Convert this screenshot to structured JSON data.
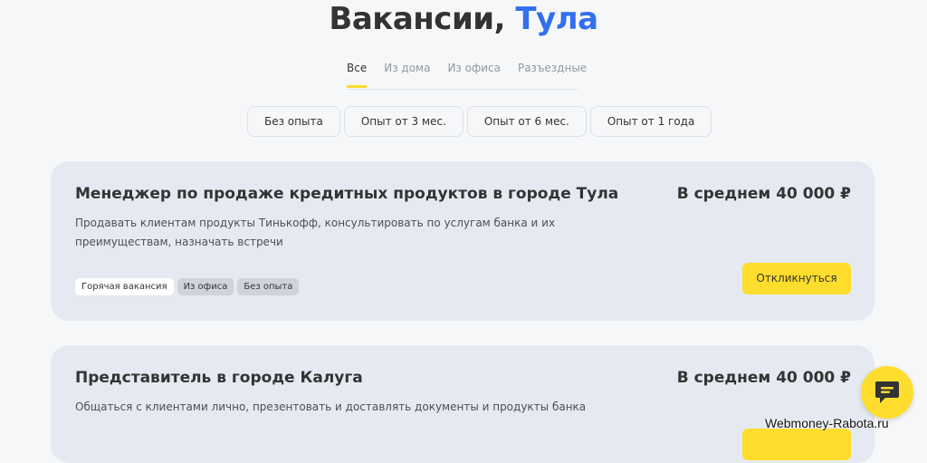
{
  "header": {
    "title_main": "Вакансии, ",
    "title_city": "Тула"
  },
  "tabs": [
    {
      "label": "Все",
      "active": true
    },
    {
      "label": "Из дома",
      "active": false
    },
    {
      "label": "Из офиса",
      "active": false
    },
    {
      "label": "Разъездные",
      "active": false
    }
  ],
  "filters": [
    "Без опыта",
    "Опыт от 3 мес.",
    "Опыт от 6 мес.",
    "Опыт от 1 года"
  ],
  "vacancies": [
    {
      "title": "Менеджер по продаже кредитных продуктов в городе Тула",
      "salary": "В среднем 40 000 ₽",
      "description": "Продавать клиентам продукты Тинькофф, консультировать по услугам банка и их преимуществам, назначать встречи",
      "badges": [
        "Горячая вакансия",
        "Из офиса",
        "Без опыта"
      ],
      "apply_label": "Откликнуться"
    },
    {
      "title": "Представитель в городе Калуга",
      "salary": "В среднем 40 000 ₽",
      "description": "Общаться с клиентами лично, презентовать и доставлять документы и продукты банка"
    }
  ],
  "watermark": "Webmoney-Rabota.ru",
  "colors": {
    "accent_yellow": "#ffdd2d",
    "accent_blue": "#336fee",
    "card_bg": "#e5eaf2"
  },
  "icons": {
    "chat": "chat-bubble-icon"
  }
}
